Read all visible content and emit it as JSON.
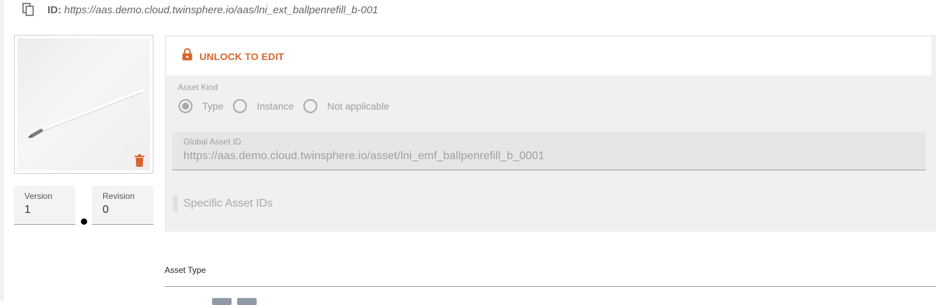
{
  "header": {
    "id_label": "ID:",
    "id_value": "https://aas.demo.cloud.twinsphere.io/aas/lni_ext_ballpenrefill_b-001",
    "copy_icon": "copy-icon"
  },
  "thumbnail": {
    "delete_icon": "trash-icon",
    "accent_color": "#d8642a"
  },
  "version": {
    "version_label": "Version",
    "version_value": "1",
    "revision_label": "Revision",
    "revision_value": "0"
  },
  "asset_info": {
    "unlock_label": "UNLOCK TO EDIT",
    "lock_icon": "lock-icon",
    "asset_kind_label": "Asset Kind",
    "asset_kind_options": [
      "Type",
      "Instance",
      "Not applicable"
    ],
    "asset_kind_selected": "Type",
    "global_asset_id_label": "Global Asset ID",
    "global_asset_id_value": "https://aas.demo.cloud.twinsphere.io/asset/lni_emf_ballpenrefill_b_0001",
    "specific_asset_ids_label": "Specific Asset IDs"
  },
  "asset_type": {
    "label": "Asset Type"
  }
}
